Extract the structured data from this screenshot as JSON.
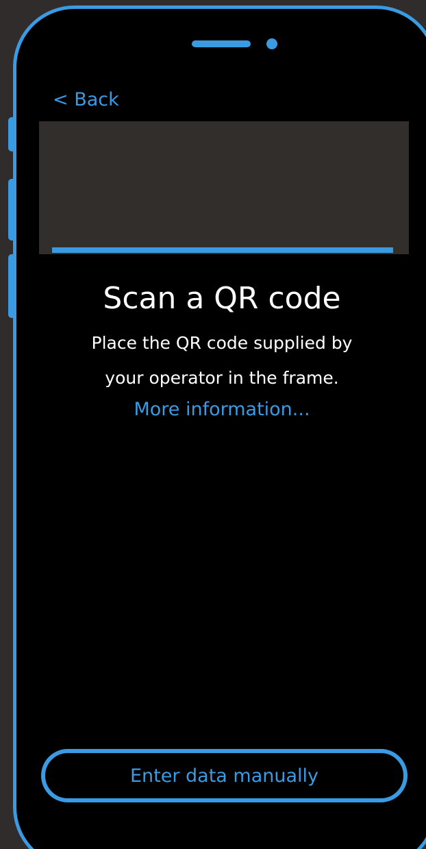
{
  "header": {
    "back_label": "< Back"
  },
  "scanner": {
    "title": "Scan a QR code",
    "description_line1": "Place the QR code supplied by",
    "description_line2": "your operator in the frame.",
    "more_info_label": "More information..."
  },
  "actions": {
    "manual_entry_label": "Enter data manually"
  },
  "colors": {
    "accent": "#3a9be3",
    "screen_background": "#000000",
    "camera_placeholder": "#312e2c",
    "page_background": "#2f2c2b"
  },
  "icons": [
    "speaker-grille",
    "front-camera"
  ]
}
